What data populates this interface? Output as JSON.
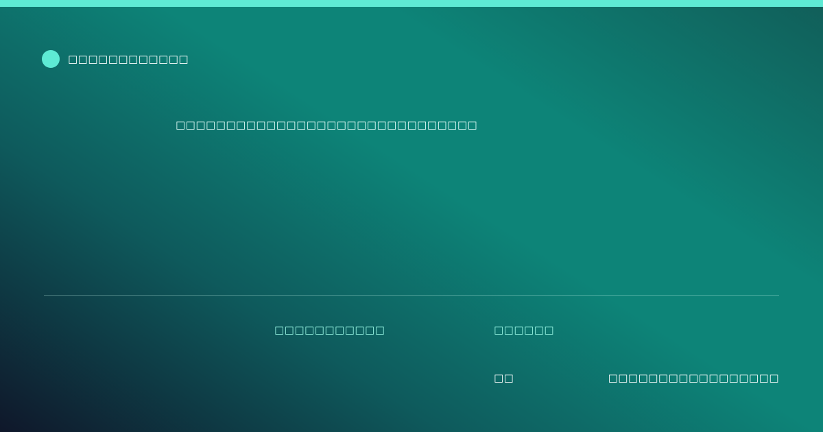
{
  "colors": {
    "accent": "#5eead4",
    "accent_text": "#99f6e4",
    "background_start": "#0f172a",
    "background_mid": "#0d8478",
    "background_end": "#115e59"
  },
  "brand": {
    "icon": "circle-logo-icon",
    "name": "□□□□□□□□□□□□"
  },
  "headline": "□□□□□□□□□□□□□□□□□□□□□□□□□□□□□□",
  "meta": {
    "left": "□□□□□□□□□□□",
    "right": "□□□□□□"
  },
  "footer": {
    "short": "□□",
    "long": "□□□□□□□□□□□□□□□□□"
  }
}
